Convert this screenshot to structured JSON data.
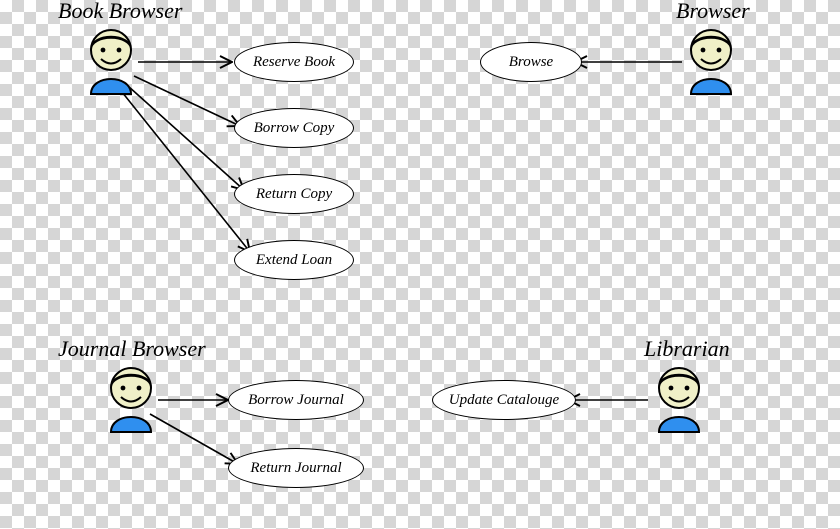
{
  "actors": {
    "book_browser": {
      "label": "Book Browser"
    },
    "browser": {
      "label": "Browser"
    },
    "journal_browser": {
      "label": "Journal Browser"
    },
    "librarian": {
      "label": "Librarian"
    }
  },
  "usecases": {
    "reserve_book": "Reserve Book",
    "borrow_copy": "Borrow Copy",
    "return_copy": "Return Copy",
    "extend_loan": "Extend Loan",
    "browse": "Browse",
    "borrow_journal": "Borrow Journal",
    "return_journal": "Return Journal",
    "update_catalogue": "Update Catalouge"
  }
}
